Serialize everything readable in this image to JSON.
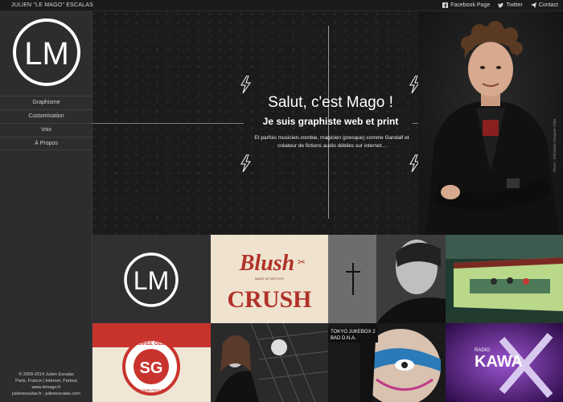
{
  "topbar": {
    "brand": "JULIEN \"LE MAGO\" ESCALAS",
    "links": [
      {
        "label": "Facebook Page",
        "icon": "facebook-icon"
      },
      {
        "label": "Twitter",
        "icon": "twitter-icon"
      },
      {
        "label": "Contact",
        "icon": "send-icon"
      }
    ]
  },
  "sidebar": {
    "logo": "LM",
    "nav": [
      "Graphisme",
      "Customisation",
      "Voix",
      "À Propos"
    ],
    "footer": [
      "© 2009-2014 Julien Escalas",
      "Paris, France | Internet, Partout",
      "www.lemago.fr",
      "julienescalas.fr - julienescalas.com"
    ]
  },
  "hero": {
    "heading": "Salut, c'est Mago !",
    "subheading": "Je suis graphiste web et print",
    "body_line1": "Et parfois musicien-zombie, magicien (presque) comme Gandalf et",
    "body_line2": "créateur de fictions audio débiles sur internet...",
    "photo_credit": "Photo : Sébastien Pasquier-Gillet"
  },
  "portfolio": {
    "tile_logo": "LM",
    "tile_blush_top": "Blush",
    "tile_blush_bottom": "CRUSH",
    "tile_blush_small": "MAKE UP ARTISTS",
    "tile_soiree_ring": "SOIREE GEEK",
    "tile_soiree_ring2": "COMMUNIQUÉ",
    "tile_soiree_letters": "SG",
    "tile_tokyo_line1": "TOKYO JUKEBOX 2",
    "tile_tokyo_line2": "BAD D.N.A.",
    "tile_kawa_small": "RADIO",
    "tile_kawa_big": "KAWA"
  },
  "colors": {
    "sidebar_bg": "#2d2d2f",
    "topbar_bg": "#1b1b1c",
    "blush_red": "#b1322a",
    "soiree_red": "#c8342d",
    "kawa_purple": "#6a2a9c"
  }
}
